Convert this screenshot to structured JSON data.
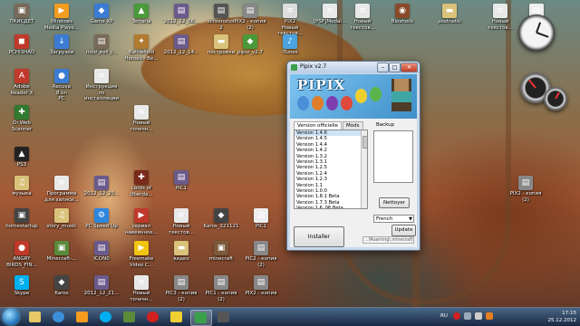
{
  "desktop": {
    "icons": [
      {
        "label": "ПКИСДЕТ",
        "color": "#7a6a5a",
        "glyph": "▣"
      },
      {
        "label": "Windows\nMedia Playe...",
        "color": "#f39c1f",
        "glyph": "▶"
      },
      {
        "label": "Game XP",
        "color": "#3b7bd4",
        "glyph": "◆"
      },
      {
        "label": "Terraria",
        "color": "#4a9a3a",
        "glyph": "▲"
      },
      {
        "label": "2012_12_06...",
        "color": "#6b5b8c",
        "glyph": "▤"
      },
      {
        "label": "screenshot\n2",
        "color": "#555555",
        "glyph": "▤"
      },
      {
        "label": "PIX2 - копия\n(2)",
        "color": "#888888",
        "glyph": "▤"
      },
      {
        "label": "PIX2\nНовый\nтекстов...",
        "color": "#dddddd",
        "glyph": "≡"
      },
      {
        "label": "[PSP]Medal...",
        "color": "#e8e8e8",
        "glyph": "≡"
      },
      {
        "label": "Новый\nтекстов...",
        "color": "#e8e8e8",
        "glyph": "≡"
      },
      {
        "label": "Bioshock",
        "color": "#8a4a2a",
        "glyph": "◉"
      },
      {
        "label": "postnetki",
        "color": "#d9c27a",
        "glyph": "▬"
      },
      {
        "label": "Новый\nтекстов...",
        "color": "#e8e8e8",
        "glyph": "≡"
      },
      {
        "label": "BioShock\nPS",
        "color": "#eeeeee",
        "glyph": "▤"
      },
      {
        "label": "PCHI3HAD",
        "color": "#c0392b",
        "glyph": "◼"
      },
      {
        "label": "Загрузки",
        "color": "#3b7bd4",
        "glyph": "↓"
      },
      {
        "label": "mod_evil_r...",
        "color": "#7a6a5a",
        "glyph": "▤"
      },
      {
        "label": "Battlefield\nHeroes - Be...",
        "color": "#b07a30",
        "glyph": "✦"
      },
      {
        "label": "2012_12_14...",
        "color": "#6b5b8c",
        "glyph": "▤"
      },
      {
        "label": "постройки",
        "color": "#d9c27a",
        "glyph": "▬"
      },
      {
        "label": "pipix_v2.7",
        "color": "#4a9a3a",
        "glyph": "◆"
      },
      {
        "label": "iTunes",
        "color": "#4aa3df",
        "glyph": "♪"
      },
      {
        "label": "Adobe\nReader X",
        "color": "#c0392b",
        "glyph": "A"
      },
      {
        "label": "Recuva\n8 on\nPC",
        "color": "#3b7bd4",
        "glyph": "●"
      },
      {
        "label": "Инструкция\nпо\nинсталляции",
        "color": "#e8e8e8",
        "glyph": "≡"
      },
      {
        "label": "Новый\nточечн...",
        "color": "#e8e8e8",
        "glyph": "≡"
      },
      {
        "label": "Dr.Web\nScanner",
        "color": "#2f7a2f",
        "glyph": "✚"
      },
      {
        "label": "PS3",
        "color": "#222222",
        "glyph": "▲"
      },
      {
        "label": "Lords of\nUberda...",
        "color": "#7a2a1a",
        "glyph": "✚"
      },
      {
        "label": "PIC1",
        "color": "#6b5b8c",
        "glyph": "▤"
      },
      {
        "label": "музыка",
        "color": "#d9c27a",
        "glyph": "♫"
      },
      {
        "label": "Программа\nдля записи...",
        "color": "#e8e8e8",
        "glyph": "≡"
      },
      {
        "label": "2012_12_25...",
        "color": "#6b5b8c",
        "glyph": "▤"
      },
      {
        "label": "homestartup",
        "color": "#444444",
        "glyph": "▣"
      },
      {
        "label": "story_music",
        "color": "#d9c27a",
        "glyph": "♫"
      },
      {
        "label": "PC Speed Up",
        "color": "#2e86de",
        "glyph": "⚙"
      },
      {
        "label": "сериал\nнавеянное...",
        "color": "#c0392b",
        "glyph": "▶"
      },
      {
        "label": "Новый\nтекстов...",
        "color": "#e8e8e8",
        "glyph": "≡"
      },
      {
        "label": "Karos_321121",
        "color": "#444444",
        "glyph": "◆"
      },
      {
        "label": "PIC1",
        "color": "#eeeeee",
        "glyph": "▤"
      },
      {
        "label": "ANGRY\nBIRDS_FIN...",
        "color": "#c0392b",
        "glyph": "●"
      },
      {
        "label": "Minecraft-...",
        "color": "#5a8a3a",
        "glyph": "▣"
      },
      {
        "label": "ICON0",
        "color": "#6b5b8c",
        "glyph": "▤"
      },
      {
        "label": "Freemake\nVideo C...",
        "color": "#f1c40f",
        "glyph": "▶"
      },
      {
        "label": "видео",
        "color": "#d9c27a",
        "glyph": "▬"
      },
      {
        "label": "minecraft",
        "color": "#7a5a3a",
        "glyph": "▣"
      },
      {
        "label": "PIC2 - копия\n(2)",
        "color": "#888888",
        "glyph": "▤"
      },
      {
        "label": "Skype",
        "color": "#00aff0",
        "glyph": "S"
      },
      {
        "label": "Karos",
        "color": "#444444",
        "glyph": "◆"
      },
      {
        "label": "2012_12_21...",
        "color": "#6b5b8c",
        "glyph": "▤"
      },
      {
        "label": "Новый\nточечн...",
        "color": "#e8e8e8",
        "glyph": "≡"
      },
      {
        "label": "PIC3 - копия\n(2)",
        "color": "#888888",
        "glyph": "▤"
      },
      {
        "label": "PIC1 - копия\n(2)",
        "color": "#888888",
        "glyph": "▤"
      },
      {
        "label": "PIX2 - копия",
        "color": "#888888",
        "glyph": "▤"
      },
      {
        "label": "PIX2 - копия\n(2)",
        "color": "#888888",
        "glyph": "▤"
      }
    ]
  },
  "pipix": {
    "title": "Pipix v2.7",
    "logo": "PIPIX",
    "tab_versions": "Version officielle",
    "tab_mods": "Mods",
    "backup_label": "Backup",
    "versions": [
      "Version 1.4.6",
      "Version 1.4.5",
      "Version 1.4.4",
      "Version 1.4.2",
      "Version 1.3.2",
      "Version 1.3.1",
      "Version 1.2.5",
      "Version 1.2.4",
      "Version 1.2.3",
      "Version 1.1",
      "Version 1.0.0",
      "Version 1.8.1 Beta",
      "Version 1.7.3 Beta",
      "Version 1.6_06 Beta"
    ],
    "nettoyer": "Nettoyer",
    "language": "French",
    "update": "Update",
    "installer": "Installer",
    "path": "...\\Roaming\\.minecraft"
  },
  "taskbar": {
    "lang": "RU",
    "time": "17:15",
    "date": "25.12.2012"
  }
}
